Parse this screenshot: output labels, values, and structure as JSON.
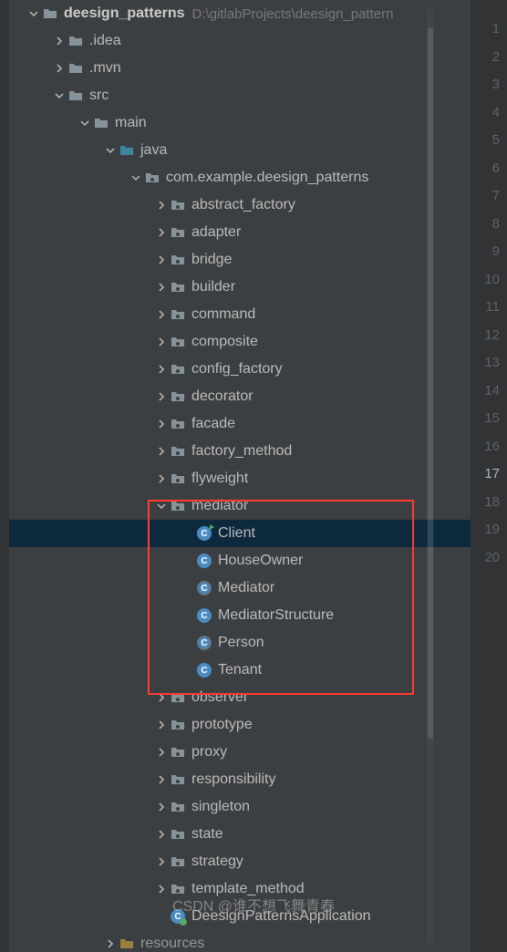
{
  "project": {
    "name": "deesign_patterns",
    "path": "D:\\gitlabProjects\\deesign_pattern"
  },
  "tree": {
    "idea": ".idea",
    "mvn": ".mvn",
    "src": "src",
    "main": "main",
    "java": "java",
    "pkg": "com.example.deesign_patterns",
    "abstract_factory": "abstract_factory",
    "adapter": "adapter",
    "bridge": "bridge",
    "builder": "builder",
    "command": "command",
    "composite": "composite",
    "config_factory": "config_factory",
    "decorator": "decorator",
    "facade": "facade",
    "factory_method": "factory_method",
    "flyweight": "flyweight",
    "mediator": "mediator",
    "Client": "Client",
    "HouseOwner": "HouseOwner",
    "Mediator": "Mediator",
    "MediatorStructure": "MediatorStructure",
    "Person": "Person",
    "Tenant": "Tenant",
    "observer": "observer",
    "prototype": "prototype",
    "proxy": "proxy",
    "responsibility": "responsibility",
    "singleton": "singleton",
    "state": "state",
    "strategy": "strategy",
    "template_method": "template_method",
    "DeesignPatternsApplication": "DeesignPatternsApplication",
    "resources": "resources"
  },
  "gutter": [
    "1",
    "2",
    "3",
    "4",
    "5",
    "6",
    "7",
    "8",
    "9",
    "10",
    "11",
    "12",
    "13",
    "14",
    "15",
    "16",
    "17",
    "18",
    "19",
    "20"
  ],
  "active_line": "17",
  "watermark": "CSDN @谁不想飞舞青春"
}
